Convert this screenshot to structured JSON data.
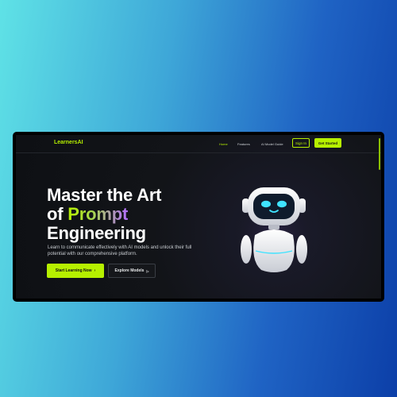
{
  "nav": {
    "brand": "LearnersAI",
    "links": [
      {
        "label": "Home",
        "active": true
      },
      {
        "label": "Features",
        "active": false
      },
      {
        "label": "AI Model Guide",
        "active": false
      }
    ],
    "sign_in": "Sign In",
    "get_started": "Get Started"
  },
  "hero": {
    "title_line1": "Master the Art",
    "title_of": "of",
    "title_highlight": "Prompt",
    "title_line3": "Engineering",
    "description": "Learn to communicate effectively with AI models and unlock their full potential with our comprehensive platform.",
    "primary_button": "Start Learning Now",
    "primary_icon": "›",
    "secondary_button": "Explore Models",
    "secondary_icon": "▷"
  },
  "colors": {
    "accent": "#b6f000",
    "background": "#121418",
    "robot_eyes": "#3fe3ff"
  },
  "icons": {
    "robot": "robot-mascot-icon",
    "chevron": "chevron-right-icon",
    "play": "play-icon"
  }
}
